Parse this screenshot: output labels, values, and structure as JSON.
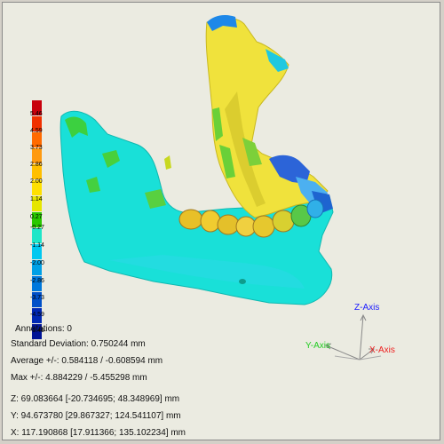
{
  "legend": {
    "ticks": [
      "5.46",
      "4.59",
      "3.73",
      "2.86",
      "2.00",
      "1.14",
      "0.27",
      "-0.27",
      "-1.14",
      "-2.00",
      "-2.86",
      "-3.73",
      "-4.59",
      "-5.46"
    ],
    "colors": [
      "#c8000c",
      "#f03000",
      "#ff6a00",
      "#ff9a10",
      "#ffbf00",
      "#ffe000",
      "#e6e600",
      "#28c800",
      "#1ee6c8",
      "#00c8f0",
      "#00a0e6",
      "#0078dc",
      "#0050c8",
      "#0028b4",
      "#001496"
    ]
  },
  "stats": {
    "annotations": "Annotations: 0",
    "std_dev": "Standard Deviation: 0.750244 mm",
    "average": "Average +/-: 0.584118 / -0.608594 mm",
    "max": "Max +/-: 4.884229 / -5.455298 mm",
    "z": "Z: 69.083664 [-20.734695; 48.348969] mm",
    "y": "Y: 94.673780 [29.867327; 124.541107] mm",
    "x": "X: 117.190868 [17.911366; 135.102234] mm"
  },
  "axes": {
    "z_label": "Z-Axis",
    "y_label": "Y-Axis",
    "x_label": "X-Axis",
    "z_color": "#1a1aff",
    "y_color": "#22cc22",
    "x_color": "#ee2020"
  }
}
